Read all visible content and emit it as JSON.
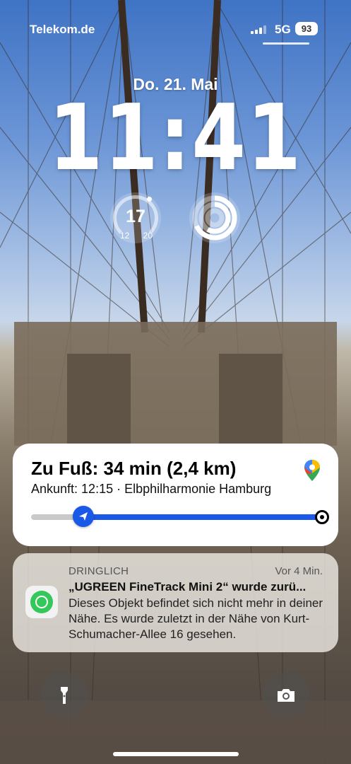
{
  "status": {
    "carrier": "Telekom.de",
    "network": "5G",
    "battery": "93"
  },
  "lockscreen": {
    "date": "Do. 21. Mai",
    "time": "11:41"
  },
  "widgets": {
    "temperature": {
      "current": "17",
      "low": "12",
      "high": "20"
    },
    "fitness": {
      "icon": "activity-rings-icon"
    }
  },
  "maps_activity": {
    "title": "Zu Fuß: 34 min (2,4 km)",
    "subtitle": "Ankunft: 12:15 · Elbphilharmonie Hamburg",
    "progress": 0.18,
    "accent": "#1a58e8",
    "icon": "maps-pin-icon"
  },
  "notification": {
    "app": "DRINGLICH",
    "time": "Vor 4 Min.",
    "title": "„UGREEN FineTrack Mini 2“ wurde zurü...",
    "body": "Dieses Objekt befindet sich nicht mehr in deiner Nähe. Es wurde zuletzt in der Nähe von Kurt-Schumacher-Allee 16 gesehen.",
    "icon": "find-my-icon"
  },
  "quick_actions": {
    "left": "flashlight-icon",
    "right": "camera-icon"
  }
}
